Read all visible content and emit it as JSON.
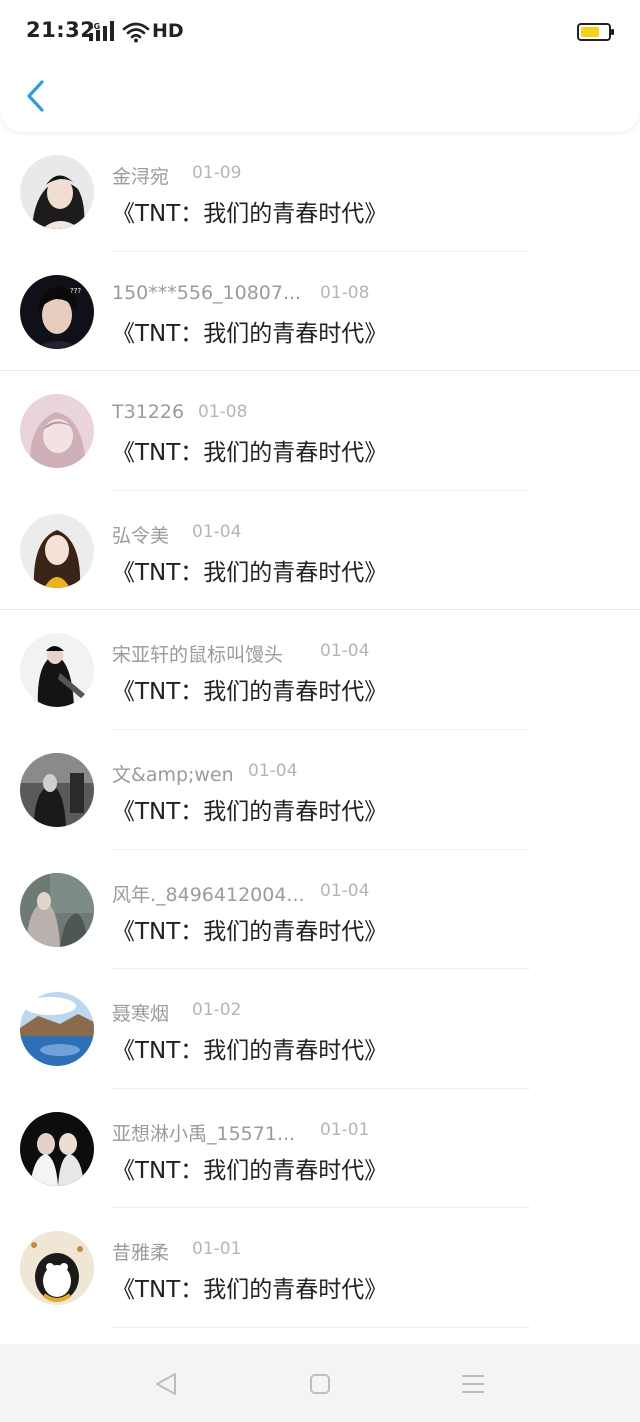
{
  "status_bar": {
    "time": "21:32",
    "network": "4G",
    "hd_label": "HD",
    "battery_color": "#f3d21a"
  },
  "header": {
    "back_icon": "chevron-left-icon",
    "accent_color": "#2d9cdb"
  },
  "items": [
    {
      "name": "金浔宛",
      "date": "01-09",
      "title": "《TNT：我们的青春时代》"
    },
    {
      "name": "150***556_10807...",
      "date": "01-08",
      "title": "《TNT：我们的青春时代》"
    },
    {
      "name": "T31226",
      "date": "01-08",
      "title": "《TNT：我们的青春时代》"
    },
    {
      "name": "弘令美",
      "date": "01-04",
      "title": "《TNT：我们的青春时代》"
    },
    {
      "name": "宋亚轩的鼠标叫馒头",
      "date": "01-04",
      "title": "《TNT：我们的青春时代》"
    },
    {
      "name": "文&amp;wen",
      "date": "01-04",
      "title": "《TNT：我们的青春时代》"
    },
    {
      "name": "风年._8496412004...",
      "date": "01-04",
      "title": "《TNT：我们的青春时代》"
    },
    {
      "name": "聂寒烟",
      "date": "01-02",
      "title": "《TNT：我们的青春时代》"
    },
    {
      "name": "亚想淋小禹_15571...",
      "date": "01-01",
      "title": "《TNT：我们的青春时代》"
    },
    {
      "name": "昔雅柔",
      "date": "01-01",
      "title": "《TNT：我们的青春时代》"
    }
  ],
  "bottom_nav": {
    "back_icon": "triangle-back-icon",
    "home_icon": "square-home-icon",
    "menu_icon": "menu-lines-icon"
  }
}
